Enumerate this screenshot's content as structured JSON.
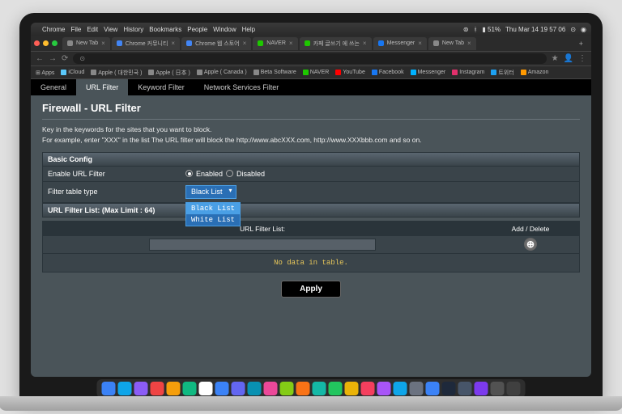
{
  "macmenu": {
    "items": [
      "Chrome",
      "File",
      "Edit",
      "View",
      "History",
      "Bookmarks",
      "People",
      "Window",
      "Help"
    ],
    "battery": "51%",
    "clock": "Thu Mar 14  19 57 06"
  },
  "browser_tabs": [
    {
      "label": "New Tab",
      "fav": "#888"
    },
    {
      "label": "Chrome 커뮤니티",
      "fav": "#4285f4"
    },
    {
      "label": "Chrome 웹 스토어",
      "fav": "#4285f4"
    },
    {
      "label": "NAVER",
      "fav": "#1ec800"
    },
    {
      "label": "카페 글쓰기 에 쓰는",
      "fav": "#1ec800"
    },
    {
      "label": "Messenger",
      "fav": "#1877f2"
    },
    {
      "label": "New Tab",
      "fav": "#888"
    }
  ],
  "url": "⊙",
  "bookmarks": [
    {
      "label": "Apps",
      "c": "#888"
    },
    {
      "label": "iCloud",
      "c": "#5ac8fa"
    },
    {
      "label": "Apple ( 대한민국 )",
      "c": "#888"
    },
    {
      "label": "Apple ( 日本 )",
      "c": "#888"
    },
    {
      "label": "Apple ( Canada )",
      "c": "#888"
    },
    {
      "label": "Beta Software",
      "c": "#888"
    },
    {
      "label": "NAVER",
      "c": "#1ec800"
    },
    {
      "label": "YouTube",
      "c": "#ff0000"
    },
    {
      "label": "Facebook",
      "c": "#1877f2"
    },
    {
      "label": "Messenger",
      "c": "#00b2ff"
    },
    {
      "label": "Instagram",
      "c": "#e1306c"
    },
    {
      "label": "트위터",
      "c": "#1da1f2"
    },
    {
      "label": "Amazon",
      "c": "#ff9900"
    }
  ],
  "page_tabs": [
    "General",
    "URL Filter",
    "Keyword Filter",
    "Network Services Filter"
  ],
  "active_tab": 1,
  "title": "Firewall - URL Filter",
  "desc1": "Key in the keywords for the sites that you want to block.",
  "desc2": "For example, enter \"XXX\" in the list The URL filter will block the http://www.abcXXX.com, http://www.XXXbbb.com and so on.",
  "basic_config": {
    "header": "Basic Config",
    "enable_label": "Enable URL Filter",
    "enabled": "Enabled",
    "disabled": "Disabled",
    "enabled_on": true,
    "filter_type_label": "Filter table type",
    "filter_type_value": "Black List",
    "options": [
      "Black List",
      "White List"
    ]
  },
  "list": {
    "header": "URL Filter List: (Max Limit : 64)",
    "col1": "URL Filter List:",
    "col2": "Add / Delete",
    "nodata": "No data in table."
  },
  "apply": "Apply",
  "dock_colors": [
    "#3b82f6",
    "#0ea5e9",
    "#8b5cf6",
    "#ef4444",
    "#f59e0b",
    "#10b981",
    "#ffffff",
    "#3b82f6",
    "#6366f1",
    "#0891b2",
    "#ec4899",
    "#84cc16",
    "#f97316",
    "#14b8a6",
    "#22c55e",
    "#eab308",
    "#f43f5e",
    "#a855f7",
    "#0ea5e9",
    "#6b7280",
    "#3b82f6",
    "#1e293b",
    "#475569",
    "#7c3aed",
    "#525252",
    "#404040"
  ]
}
